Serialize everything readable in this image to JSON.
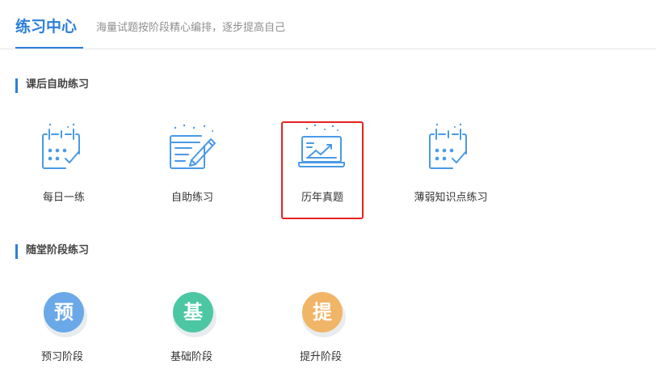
{
  "header": {
    "title": "练习中心",
    "subtitle": "海量试题按阶段精心编排，逐步提高自己",
    "accent_color": "#2b7fd8"
  },
  "sections": [
    {
      "title": "课后自助练习",
      "items": [
        {
          "label": "每日一练",
          "icon": "calendar-check-icon"
        },
        {
          "label": "自助练习",
          "icon": "notepad-pen-icon"
        },
        {
          "label": "历年真题",
          "icon": "chart-screen-icon",
          "selected": true
        },
        {
          "label": "薄弱知识点练习",
          "icon": "calendar-check-icon"
        }
      ]
    },
    {
      "title": "随堂阶段练习",
      "items": [
        {
          "label": "预习阶段",
          "glyph": "预",
          "color": "#6aa8e8"
        },
        {
          "label": "基础阶段",
          "glyph": "基",
          "color": "#4cc7a4"
        },
        {
          "label": "提升阶段",
          "glyph": "提",
          "color": "#f1b567"
        }
      ]
    }
  ],
  "selection_color": "#e52222"
}
